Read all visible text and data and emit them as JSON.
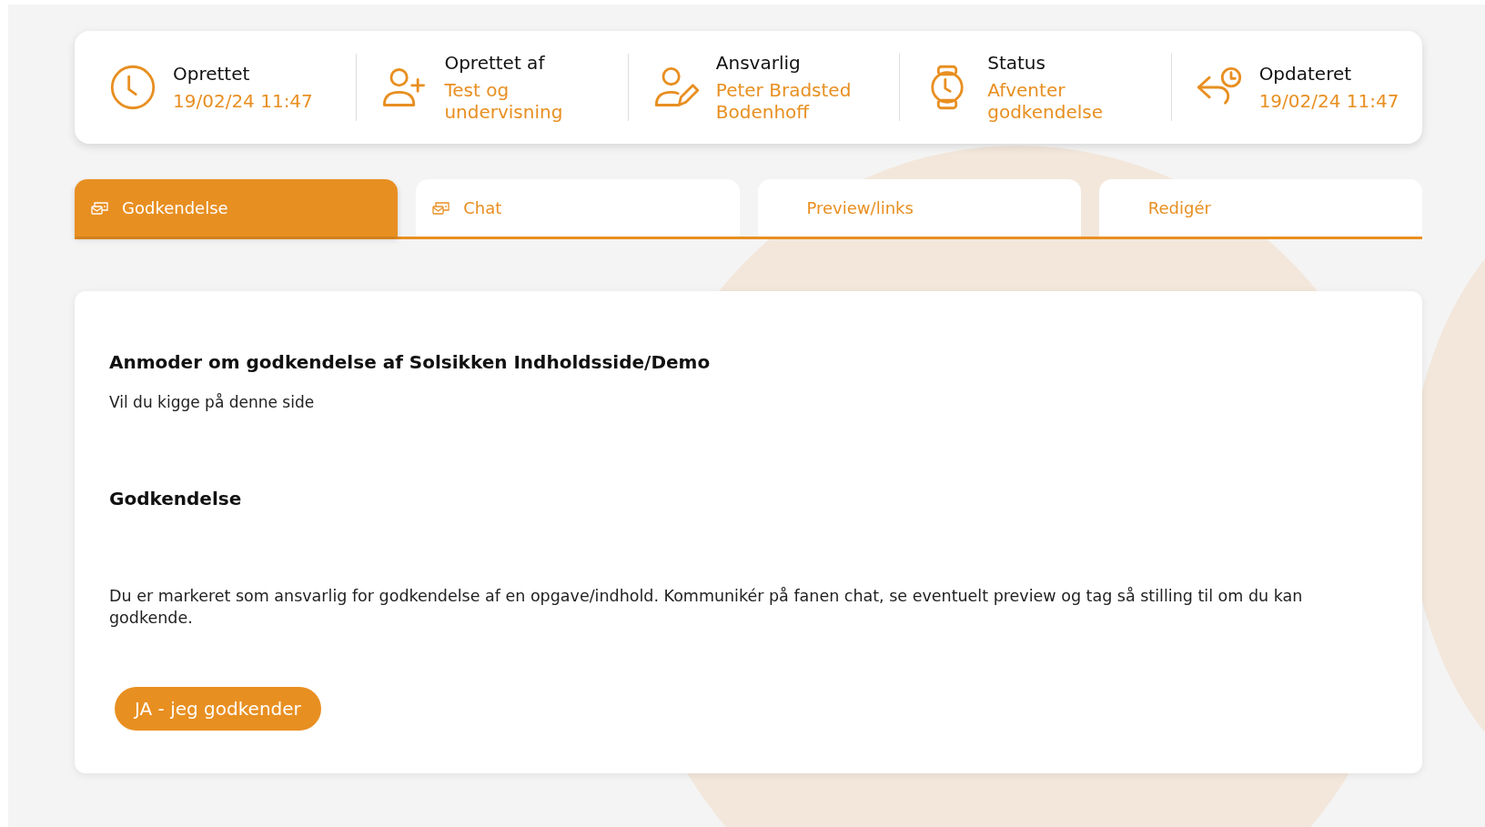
{
  "info_bar": [
    {
      "kind": "clock",
      "label": "Oprettet",
      "value": "19/02/24 11:47"
    },
    {
      "kind": "user-plus",
      "label": "Oprettet af",
      "value": "Test og undervisning"
    },
    {
      "kind": "user-pen",
      "label": "Ansvarlig",
      "value": "Peter Bradsted Bodenhoff"
    },
    {
      "kind": "watch",
      "label": "Status",
      "value": "Afventer godkendelse"
    },
    {
      "kind": "reply-clock",
      "label": "Opdateret",
      "value": "19/02/24 11:47"
    }
  ],
  "tabs": [
    {
      "label": "Godkendelse",
      "selected": true,
      "has_icon": true
    },
    {
      "label": "Chat",
      "selected": false,
      "has_icon": true
    },
    {
      "label": "Preview/links",
      "selected": false,
      "has_icon": false
    },
    {
      "label": "Redigér",
      "selected": false,
      "has_icon": false
    }
  ],
  "panel": {
    "title": "Anmoder om godkendelse af Solsikken Indholdsside/Demo",
    "message": "Vil du kigge på denne side",
    "section_title": "Godkendelse",
    "description": "Du er markeret som ansvarlig for godkendelse af en opgave/indhold. Kommunikér på fanen chat, se eventuelt preview og tag så stilling til om du kan godkende.",
    "approve_button": "JA - jeg godkender"
  }
}
